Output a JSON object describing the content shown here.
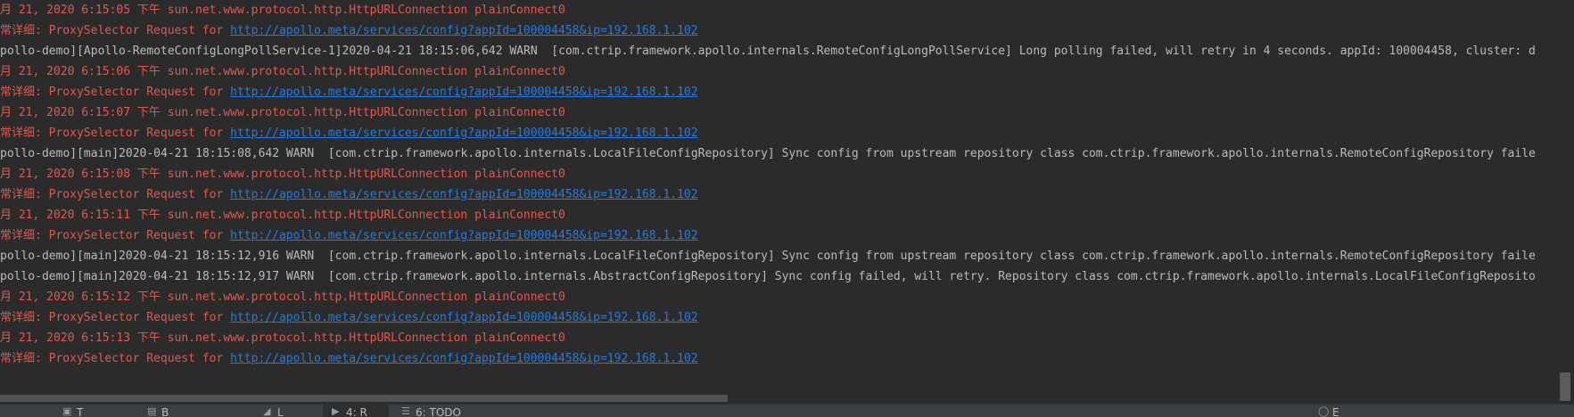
{
  "console": {
    "lines": [
      {
        "type": "date",
        "text": "月 21, 2020 6:15:05 下午 sun.net.www.protocol.http.HttpURLConnection plainConnect0"
      },
      {
        "type": "proxy",
        "prefix": "常详细: ProxySelector Request for ",
        "url": "http://apollo.meta/services/config?appId=100004458&ip=192.168.1.102"
      },
      {
        "type": "warn",
        "text": "pollo-demo][Apollo-RemoteConfigLongPollService-1]2020-04-21 18:15:06,642 WARN  [com.ctrip.framework.apollo.internals.RemoteConfigLongPollService] Long polling failed, will retry in 4 seconds. appId: 100004458, cluster: d"
      },
      {
        "type": "date",
        "text": "月 21, 2020 6:15:06 下午 sun.net.www.protocol.http.HttpURLConnection plainConnect0"
      },
      {
        "type": "proxy",
        "prefix": "常详细: ProxySelector Request for ",
        "url": "http://apollo.meta/services/config?appId=100004458&ip=192.168.1.102"
      },
      {
        "type": "date",
        "text": "月 21, 2020 6:15:07 下午 sun.net.www.protocol.http.HttpURLConnection plainConnect0"
      },
      {
        "type": "proxy",
        "prefix": "常详细: ProxySelector Request for ",
        "url": "http://apollo.meta/services/config?appId=100004458&ip=192.168.1.102"
      },
      {
        "type": "warn",
        "text": "pollo-demo][main]2020-04-21 18:15:08,642 WARN  [com.ctrip.framework.apollo.internals.LocalFileConfigRepository] Sync config from upstream repository class com.ctrip.framework.apollo.internals.RemoteConfigRepository faile"
      },
      {
        "type": "date",
        "text": "月 21, 2020 6:15:08 下午 sun.net.www.protocol.http.HttpURLConnection plainConnect0"
      },
      {
        "type": "proxy",
        "prefix": "常详细: ProxySelector Request for ",
        "url": "http://apollo.meta/services/config?appId=100004458&ip=192.168.1.102"
      },
      {
        "type": "date",
        "text": "月 21, 2020 6:15:11 下午 sun.net.www.protocol.http.HttpURLConnection plainConnect0"
      },
      {
        "type": "proxy",
        "prefix": "常详细: ProxySelector Request for ",
        "url": "http://apollo.meta/services/config?appId=100004458&ip=192.168.1.102"
      },
      {
        "type": "warn",
        "text": "pollo-demo][main]2020-04-21 18:15:12,916 WARN  [com.ctrip.framework.apollo.internals.LocalFileConfigRepository] Sync config from upstream repository class com.ctrip.framework.apollo.internals.RemoteConfigRepository faile"
      },
      {
        "type": "warn",
        "text": "pollo-demo][main]2020-04-21 18:15:12,917 WARN  [com.ctrip.framework.apollo.internals.AbstractConfigRepository] Sync config failed, will retry. Repository class com.ctrip.framework.apollo.internals.LocalFileConfigReposito"
      },
      {
        "type": "date",
        "text": "月 21, 2020 6:15:12 下午 sun.net.www.protocol.http.HttpURLConnection plainConnect0"
      },
      {
        "type": "proxy",
        "prefix": "常详细: ProxySelector Request for ",
        "url": "http://apollo.meta/services/config?appId=100004458&ip=192.168.1.102"
      },
      {
        "type": "date",
        "text": "月 21, 2020 6:15:13 下午 sun.net.www.protocol.http.HttpURLConnection plainConnect0"
      },
      {
        "type": "proxy",
        "prefix": "常详细: ProxySelector Request for ",
        "url": "http://apollo.meta/services/config?appId=100004458&ip=192.168.1.102"
      }
    ]
  },
  "colors": {
    "background": "#2b2b2b",
    "stderr_red": "#e2584f",
    "stdout_gray": "#bbbbbb",
    "link_blue": "#287bde",
    "toolbar": "#3c3f41"
  },
  "toolbar": {
    "items": [
      {
        "icon": "terminal-icon",
        "label": "T"
      },
      {
        "icon": "hammer-icon",
        "label": "B"
      },
      {
        "icon": "list-icon",
        "label": "L"
      },
      {
        "icon": "run-icon",
        "label": "4: R"
      },
      {
        "icon": "todo-icon",
        "label": "6: TODO"
      },
      {
        "icon": "event-log-icon",
        "label": "E"
      }
    ]
  }
}
